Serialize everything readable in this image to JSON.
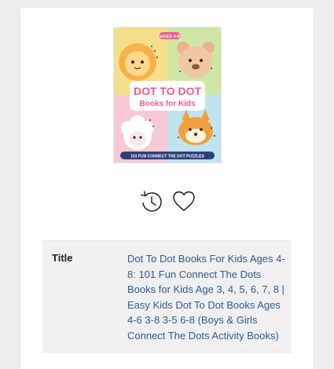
{
  "book": {
    "cover": {
      "badge": "AGES 4-8",
      "title_line1": "DOT TO DOT",
      "title_line2": "Books for Kids",
      "banner": "101 FUN CONNECT THE DOT PUZZLES",
      "colors": {
        "yellow_quadrant": "#f4e08a",
        "green_quadrant": "#cfe6a6",
        "pink_quadrant": "#f6c9d4",
        "blue_quadrant": "#bfe3ef",
        "title_pink": "#ef5a8e",
        "banner_navy": "#2f3f7a"
      }
    },
    "actions": {
      "history_icon": "history-clock-icon",
      "favorite_icon": "heart-outline-icon"
    },
    "details": {
      "title_label": "Title",
      "title_value": "Dot To Dot Books For Kids Ages 4-8: 101 Fun Connect The Dots Books for Kids Age 3, 4, 5, 6, 7, 8 | Easy Kids Dot To Dot Books Ages 4-6 3-8 3-5 6-8 (Boys & Girls Connect The Dots Activity Books)"
    }
  }
}
